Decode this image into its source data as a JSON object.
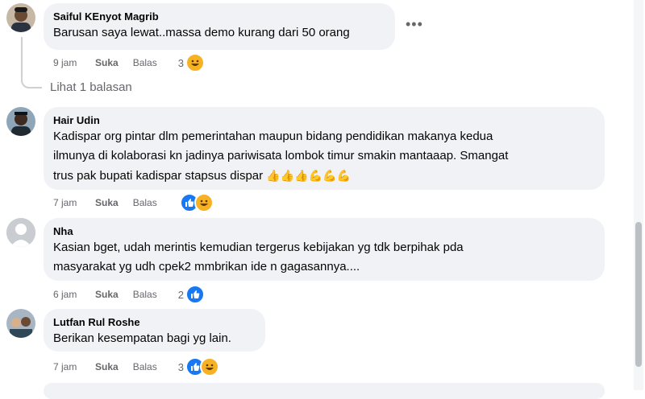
{
  "comments": [
    {
      "author": "Saiful KEnyot Magrib",
      "lines": [
        "Barusan saya lewat..massa demo kurang dari 50 orang"
      ],
      "time": "9 jam",
      "like": "Suka",
      "reply": "Balas",
      "count": "3",
      "reactions": [
        "haha"
      ]
    },
    {
      "author": "Hair Udin",
      "lines": [
        "Kadispar org pintar dlm pemerintahan maupun bidang pendidikan makanya kedua",
        "ilmunya di kolaborasi kn jadinya pariwisata lombok timur smakin mantaaap. Smangat",
        "trus pak bupati kadispar stapsus dispar"
      ],
      "emoji_tail": "👍👍👍💪💪💪",
      "time": "7 jam",
      "like": "Suka",
      "reply": "Balas",
      "count": "",
      "reactions": [
        "like",
        "haha"
      ]
    },
    {
      "author": "Nha",
      "lines": [
        "Kasian bget, udah merintis kemudian tergerus kebijakan yg tdk berpihak pda",
        "masyarakat yg udh cpek2 mmbrikan ide n gagasannya...."
      ],
      "time": "6 jam",
      "like": "Suka",
      "reply": "Balas",
      "count": "2",
      "reactions": [
        "like"
      ]
    },
    {
      "author": "Lutfan Rul Roshe",
      "lines": [
        "Berikan kesempatan bagi yg lain."
      ],
      "time": "7 jam",
      "like": "Suka",
      "reply": "Balas",
      "count": "3",
      "reactions": [
        "like",
        "haha"
      ]
    }
  ],
  "view_replies": "Lihat 1 balasan",
  "more_icon": "•••",
  "colors": {
    "bubble": "#f0f2f5",
    "meta": "#65676b",
    "like": "#1877f2",
    "haha": "#f7b125"
  }
}
